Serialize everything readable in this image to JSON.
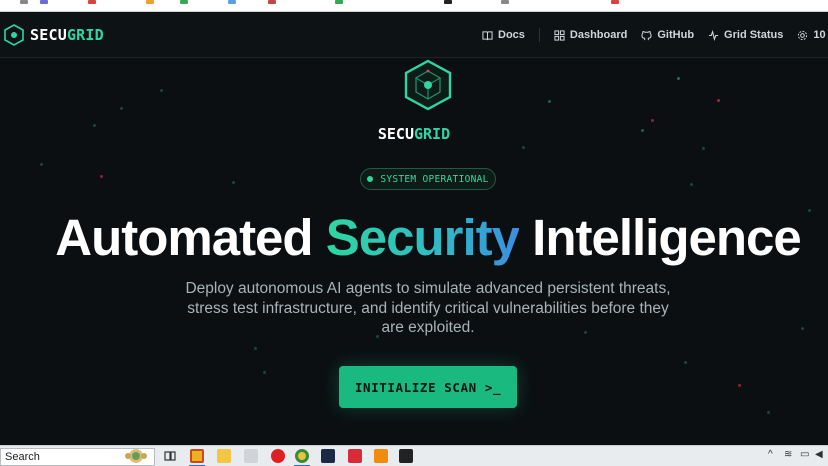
{
  "app": {
    "brand_prefix": "SECU",
    "brand_suffix": "GRID",
    "accent_color": "#2fd6a0"
  },
  "nav": {
    "items": [
      {
        "label": "Docs",
        "icon": "book-icon"
      },
      {
        "label": "Dashboard",
        "icon": "dashboard-icon"
      },
      {
        "label": "GitHub",
        "icon": "github-icon"
      },
      {
        "label": "Grid Status",
        "icon": "activity-icon"
      },
      {
        "label": "10",
        "icon": "gear-icon"
      }
    ]
  },
  "hero": {
    "brand_prefix": "SECU",
    "brand_suffix": "GRID",
    "status": "SYSTEM OPERATIONAL",
    "headline_part1": "Automated ",
    "headline_accent": "Security",
    "headline_part2": " Intelligence",
    "description": "Deploy autonomous AI agents to simulate advanced persistent threats, stress test infrastructure, and identify critical vulnerabilities before they are exploited.",
    "cta_label": "INITIALIZE SCAN >_"
  },
  "taskbar": {
    "search_label": "Search"
  }
}
